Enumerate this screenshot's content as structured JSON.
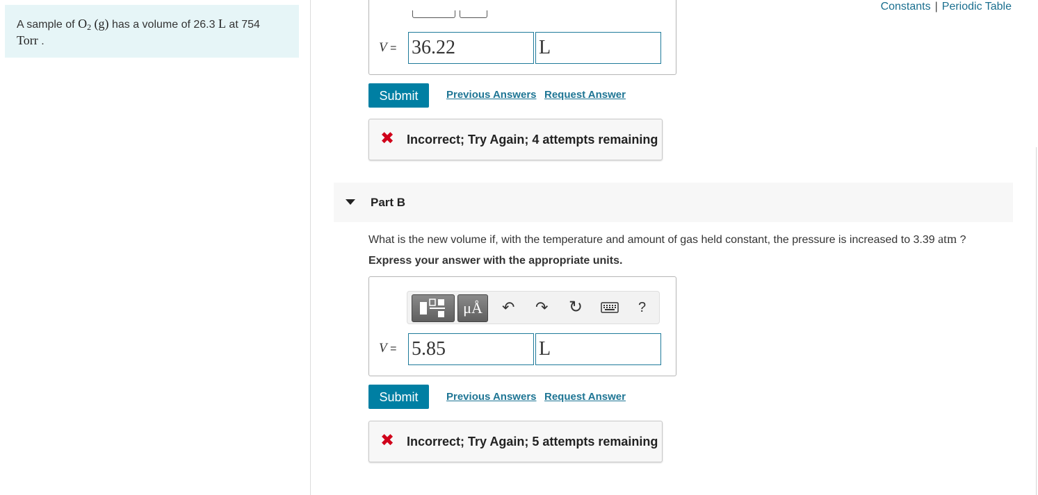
{
  "header": {
    "constants_link": "Constants",
    "separator": "|",
    "periodic_table_link": "Periodic Table"
  },
  "problem": {
    "prefix": "A sample of",
    "species": "O",
    "subscript": "2",
    "phase": "(g)",
    "mid": "has a volume of 26.3",
    "volume_unit": "L",
    "at": "at 754",
    "pressure_unit": "Torr",
    "end": "."
  },
  "part_a": {
    "v_label": "V",
    "equals": "=",
    "value": "36.22",
    "unit": "L",
    "submit": "Submit",
    "previous_answers": "Previous Answers",
    "request_answer": "Request Answer",
    "feedback_icon": "✖",
    "feedback": "Incorrect; Try Again; 4 attempts remaining"
  },
  "part_b": {
    "title": "Part B",
    "question_text": "What is the new volume if, with the temperature and amount of gas held constant, the pressure is increased to 3.39",
    "question_unit": "atm",
    "question_end": "?",
    "instruction": "Express your answer with the appropriate units.",
    "toolbar": {
      "templates_icon": "templates-icon",
      "units_label": "μÅ",
      "undo": "↶",
      "redo": "↷",
      "reset": "↻",
      "keyboard_icon": "keyboard-icon",
      "help": "?"
    },
    "v_label": "V",
    "equals": "=",
    "value": "5.85",
    "unit": "L",
    "submit": "Submit",
    "previous_answers": "Previous Answers",
    "request_answer": "Request Answer",
    "feedback_icon": "✖",
    "feedback": "Incorrect; Try Again; 5 attempts remaining"
  },
  "colors": {
    "accent": "#007fa3",
    "link": "#1e7594",
    "error": "#d0021b",
    "problem_bg": "#e6f5f7"
  }
}
